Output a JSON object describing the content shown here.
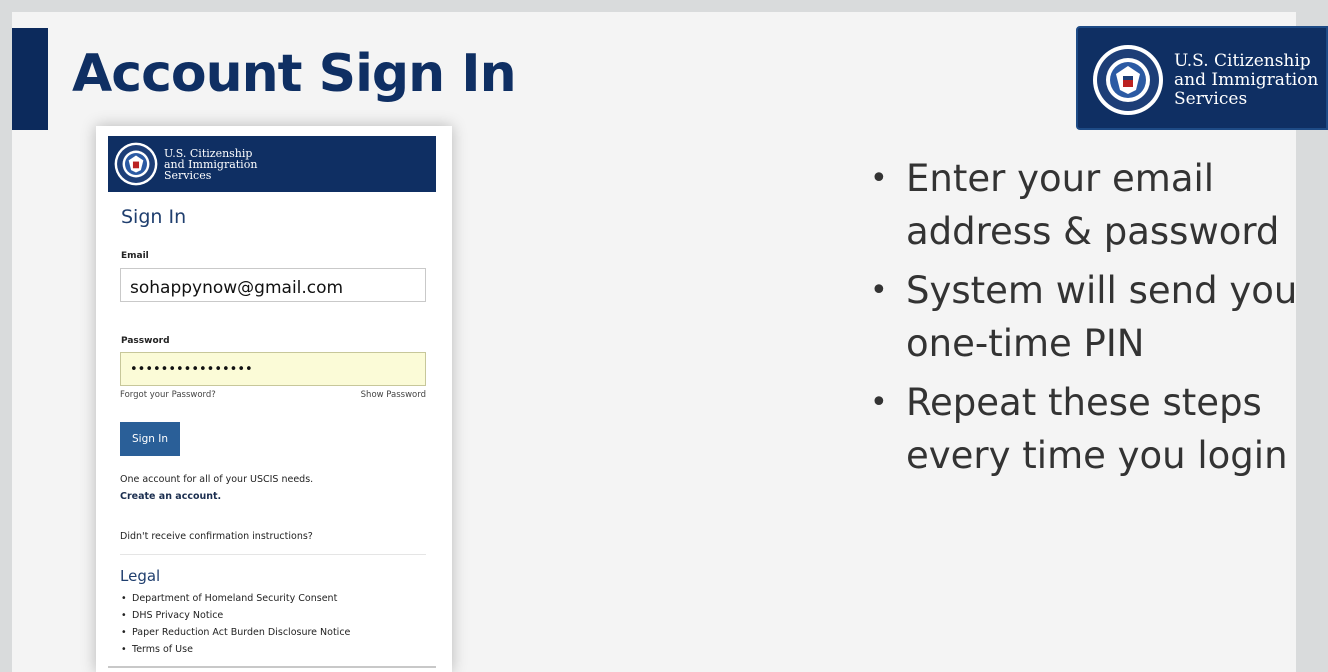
{
  "slide": {
    "title": "Account Sign In",
    "bullets": [
      "Enter your email address & password",
      "System will send you one-time PIN",
      "Repeat these steps every time you login"
    ],
    "brand": {
      "line1": "U.S. Citizenship",
      "line2": "and Immigration",
      "line3": "Services",
      "seal_icon": "dhs-seal-icon"
    }
  },
  "form": {
    "brand": {
      "line1": "U.S. Citizenship",
      "line2": "and Immigration",
      "line3": "Services"
    },
    "heading": "Sign In",
    "email_label": "Email",
    "email_value": "sohappynow@gmail.com",
    "password_label": "Password",
    "password_value": "••••••••••••••••",
    "forgot_password": "Forgot your Password?",
    "show_password": "Show Password",
    "sign_in_button": "Sign In",
    "one_account_text": "One account for all of your USCIS needs.",
    "create_account_link": "Create an account.",
    "confirmation_link": "Didn't receive confirmation instructions?",
    "legal_heading": "Legal",
    "legal_items": [
      "Department of Homeland Security Consent",
      "DHS Privacy Notice",
      "Paper Reduction Act Burden Disclosure Notice",
      "Terms of Use"
    ]
  },
  "colors": {
    "navy": "#0f2f63",
    "button": "#2a5f98",
    "password_field": "#fbfbd7",
    "slide_bg": "#f4f4f4"
  }
}
